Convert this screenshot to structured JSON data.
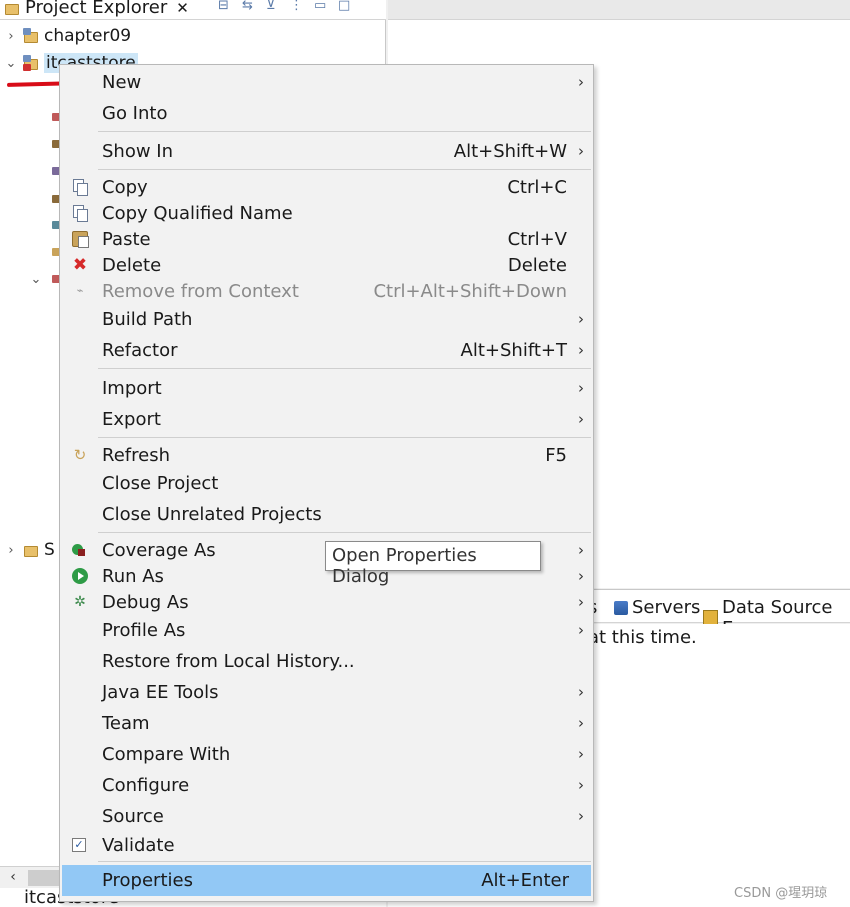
{
  "explorer": {
    "tab_title": "Project Explorer",
    "close_glyph": "✕",
    "tree": [
      {
        "label": "chapter09",
        "chevron": "›"
      },
      {
        "label": "itcaststore",
        "chevron": "⌄"
      },
      {
        "label": "S",
        "chevron": "›"
      }
    ],
    "bottom_label": "itcaststore"
  },
  "menu": {
    "items": [
      {
        "label": "New",
        "shortcut": "",
        "arrow": "›"
      },
      {
        "label": "Go Into",
        "shortcut": "",
        "arrow": ""
      },
      {
        "label": "Show In",
        "shortcut": "Alt+Shift+W",
        "arrow": "›"
      },
      {
        "label": "Copy",
        "shortcut": "Ctrl+C",
        "arrow": "",
        "icon": "copy-icon"
      },
      {
        "label": "Copy Qualified Name",
        "shortcut": "",
        "arrow": "",
        "icon": "copy-qualified-name-icon"
      },
      {
        "label": "Paste",
        "shortcut": "Ctrl+V",
        "arrow": "",
        "icon": "paste-icon"
      },
      {
        "label": "Delete",
        "shortcut": "Delete",
        "arrow": "",
        "icon": "delete-icon"
      },
      {
        "label": "Remove from Context",
        "shortcut": "Ctrl+Alt+Shift+Down",
        "arrow": "",
        "icon": "remove-context-icon",
        "disabled": true
      },
      {
        "label": "Build Path",
        "shortcut": "",
        "arrow": "›"
      },
      {
        "label": "Refactor",
        "shortcut": "Alt+Shift+T",
        "arrow": "›"
      },
      {
        "label": "Import",
        "shortcut": "",
        "arrow": "›"
      },
      {
        "label": "Export",
        "shortcut": "",
        "arrow": "›"
      },
      {
        "label": "Refresh",
        "shortcut": "F5",
        "arrow": "",
        "icon": "refresh-icon"
      },
      {
        "label": "Close Project",
        "shortcut": "",
        "arrow": ""
      },
      {
        "label": "Close Unrelated Projects",
        "shortcut": "",
        "arrow": ""
      },
      {
        "label": "Coverage As",
        "shortcut": "",
        "arrow": "›",
        "icon": "coverage-icon"
      },
      {
        "label": "Run As",
        "shortcut": "",
        "arrow": "›",
        "icon": "run-icon"
      },
      {
        "label": "Debug As",
        "shortcut": "",
        "arrow": "›",
        "icon": "debug-icon"
      },
      {
        "label": "Profile As",
        "shortcut": "",
        "arrow": "›"
      },
      {
        "label": "Restore from Local History...",
        "shortcut": "",
        "arrow": ""
      },
      {
        "label": "Java EE Tools",
        "shortcut": "",
        "arrow": "›"
      },
      {
        "label": "Team",
        "shortcut": "",
        "arrow": "›"
      },
      {
        "label": "Compare With",
        "shortcut": "",
        "arrow": "›"
      },
      {
        "label": "Configure",
        "shortcut": "",
        "arrow": "›"
      },
      {
        "label": "Source",
        "shortcut": "",
        "arrow": "›"
      },
      {
        "label": "Validate",
        "shortcut": "",
        "arrow": "",
        "icon": "validate-check-icon"
      },
      {
        "label": "Properties",
        "shortcut": "Alt+Enter",
        "arrow": "",
        "highlighted": true
      }
    ]
  },
  "tooltip": "Open Properties Dialog",
  "bottom_panel": {
    "tab_fragment": "s",
    "servers_label": "Servers",
    "datasource_label": "Data Source Ex",
    "console_message": "at this time."
  },
  "watermark": "CSDN @瑆玥琼",
  "colors": {
    "highlight": "#92c8f5",
    "annotation_red": "#d80c18",
    "selection": "#cde6f7"
  }
}
